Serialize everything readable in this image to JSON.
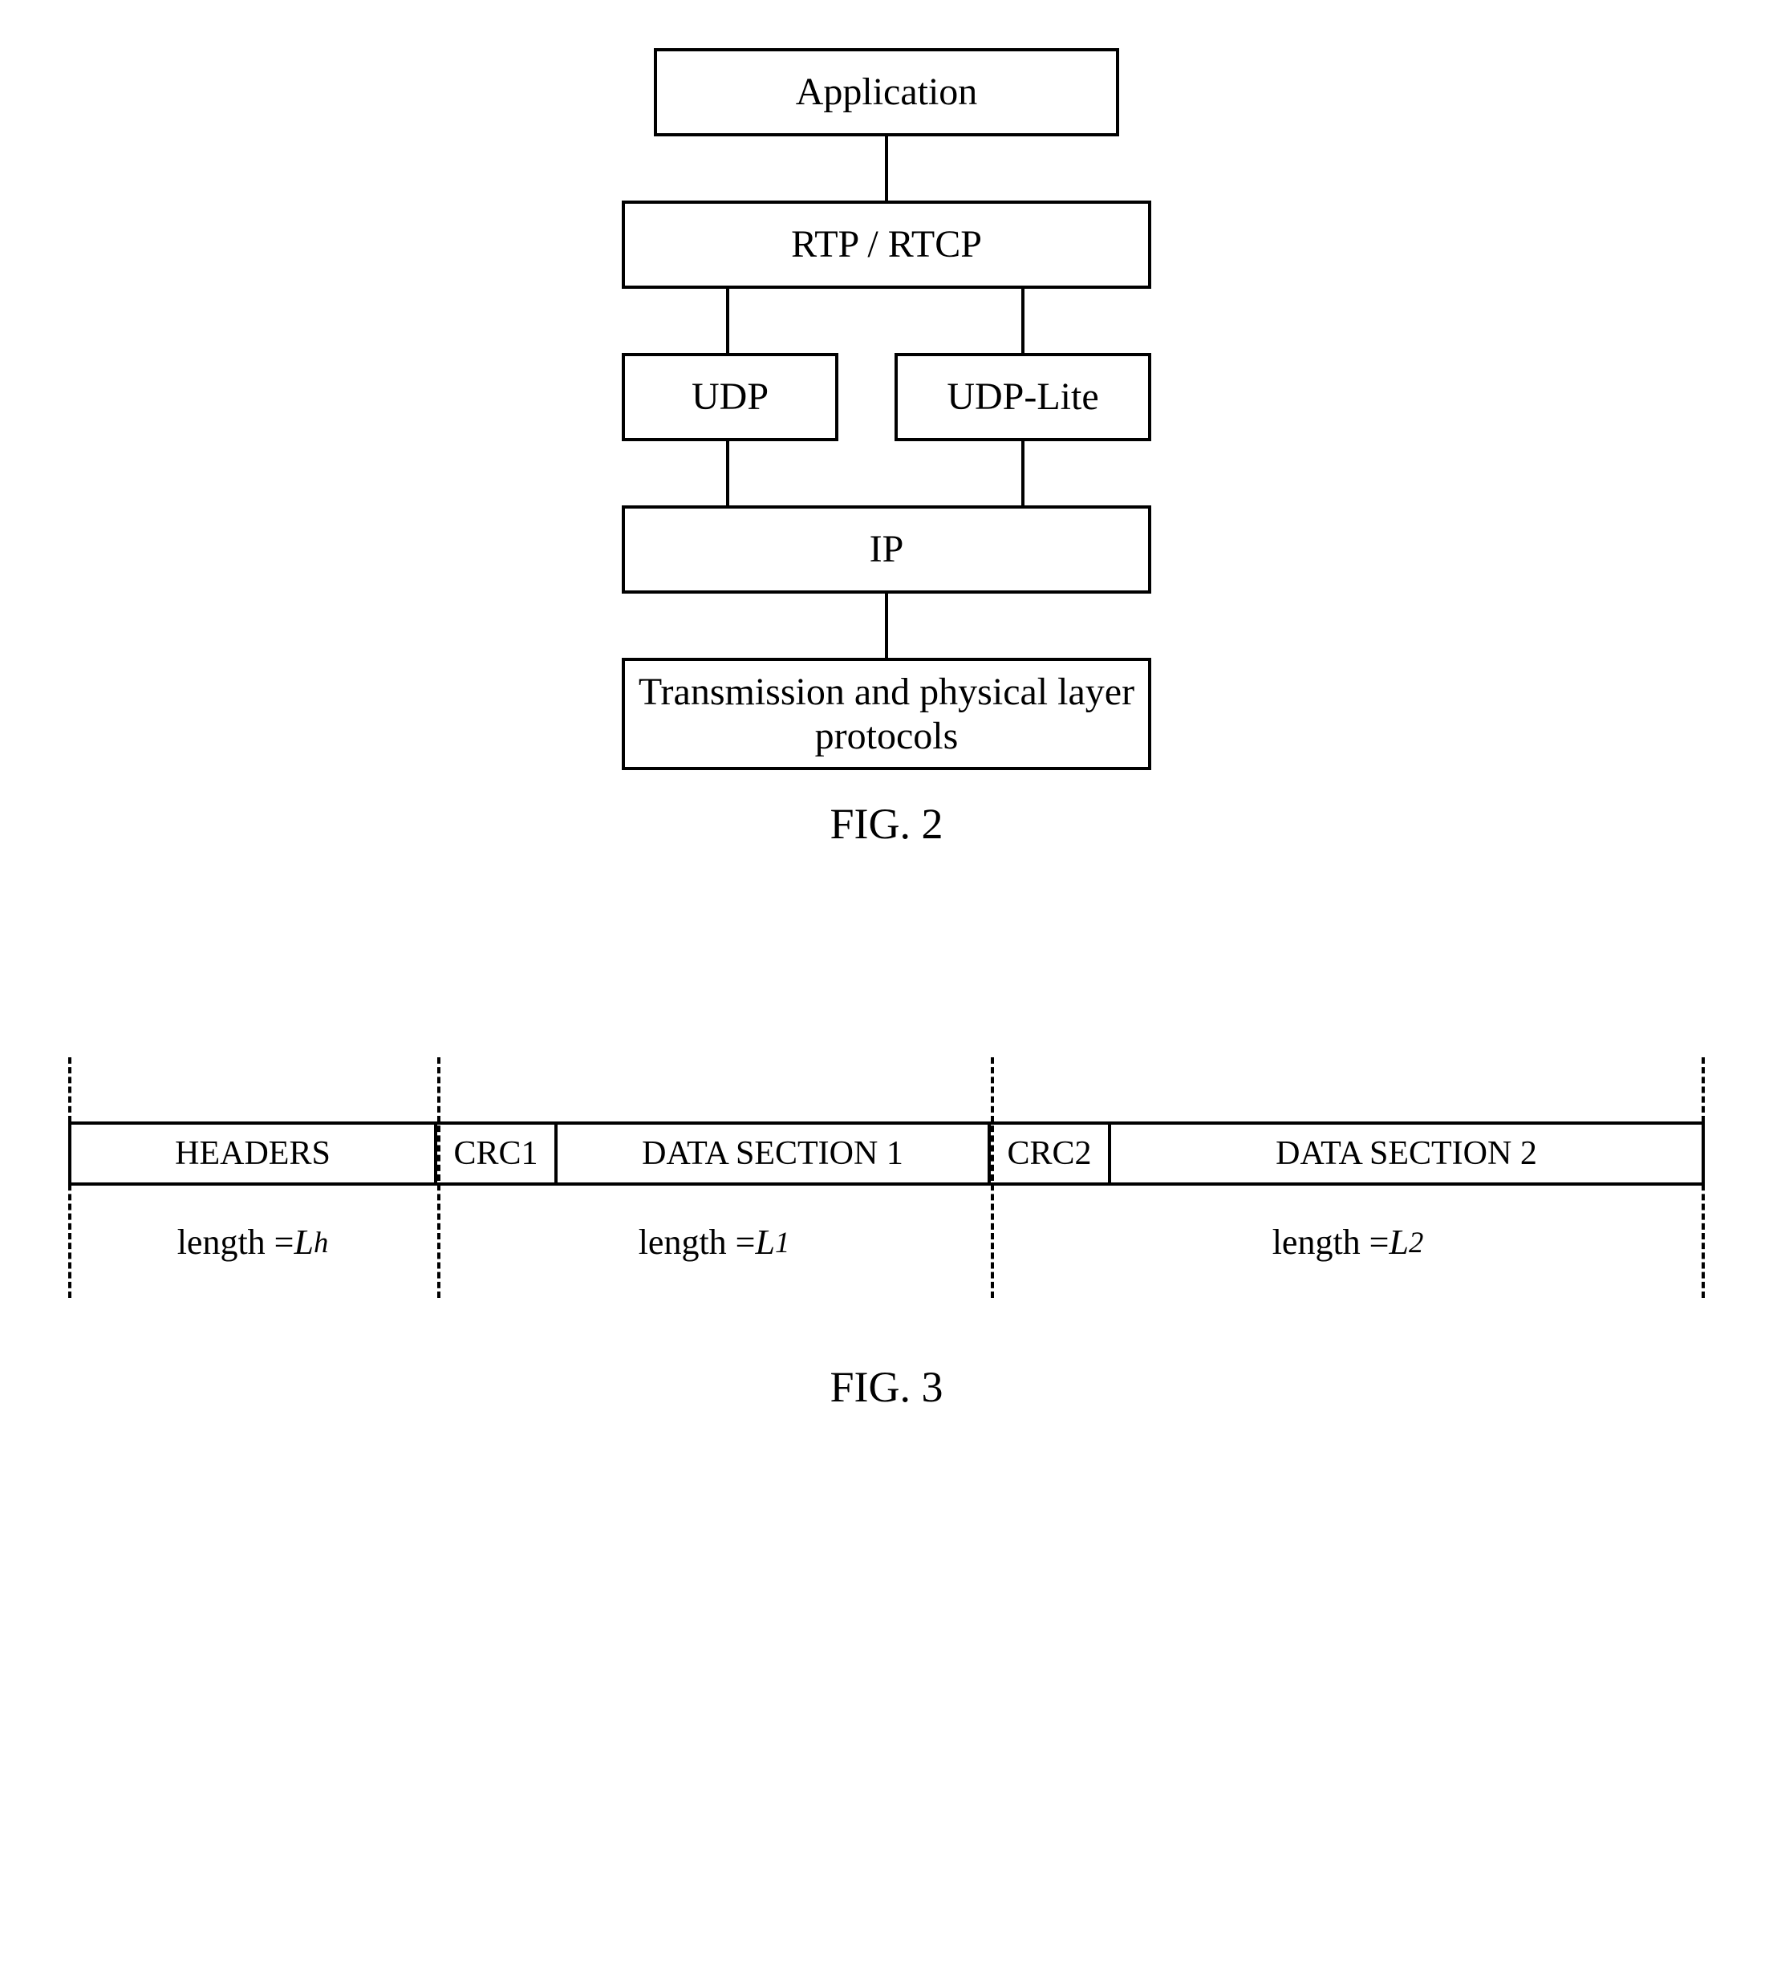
{
  "fig2": {
    "boxes": {
      "application": "Application",
      "rtp": "RTP / RTCP",
      "udp": "UDP",
      "udplite": "UDP-Lite",
      "ip": "IP",
      "phy": "Transmission and physical layer protocols"
    },
    "caption": "FIG. 2"
  },
  "fig3": {
    "segments": {
      "headers": "HEADERS",
      "crc1": "CRC1",
      "data1": "DATA SECTION 1",
      "crc2": "CRC2",
      "data2": "DATA SECTION 2"
    },
    "lengths": {
      "prefix": "length = ",
      "lh_var": "L",
      "lh_sub": "h",
      "l1_var": "L",
      "l1_sub": "1",
      "l2_var": "L",
      "l2_sub": "2"
    },
    "caption": "FIG. 3"
  }
}
